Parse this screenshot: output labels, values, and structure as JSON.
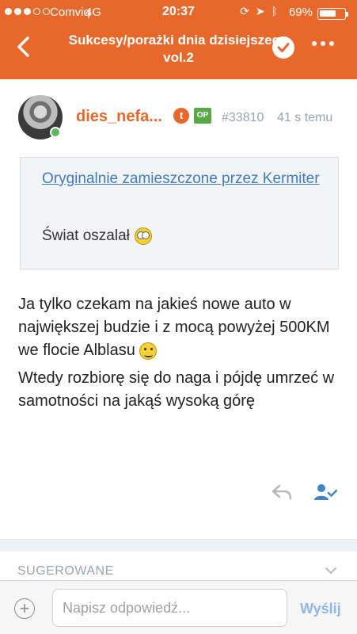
{
  "status_bar": {
    "carrier": "Comviq",
    "network": "4G",
    "time": "20:37",
    "battery_percent": "69%",
    "battery_level": 0.69,
    "signal_bars": 3,
    "signal_total": 5
  },
  "header": {
    "title": "Sukcesy/porażki dnia dzisiejszego vol.2",
    "back_icon": "chevron-left-icon",
    "check_icon": "check-circle-icon",
    "more_icon": "more-horizontal-icon",
    "accent_color": "#e8682c"
  },
  "post": {
    "username": "dies_nefa...",
    "badge_t": "t",
    "badge_op": "OP",
    "post_id": "#33810",
    "time_ago": "41 s temu",
    "quote": {
      "source": "Oryginalnie zamieszczone przez Kermiter",
      "text": "Świat oszalał"
    },
    "paragraphs": [
      "Ja tylko czekam na jakieś nowe auto w największej budzie i z mocą powyżej 500KM we flocie Alblasu",
      "Wtedy rozbiorę się do naga i pójdę umrzeć w samotności na jakąś wysoką górę"
    ],
    "reply_icon": "reply-icon",
    "user_check_icon": "user-check-icon"
  },
  "suggested": {
    "label": "SUGEROWANE"
  },
  "compose": {
    "placeholder": "Napisz odpowiedź...",
    "send_label": "Wyślij",
    "add_icon": "plus-circle-icon"
  }
}
